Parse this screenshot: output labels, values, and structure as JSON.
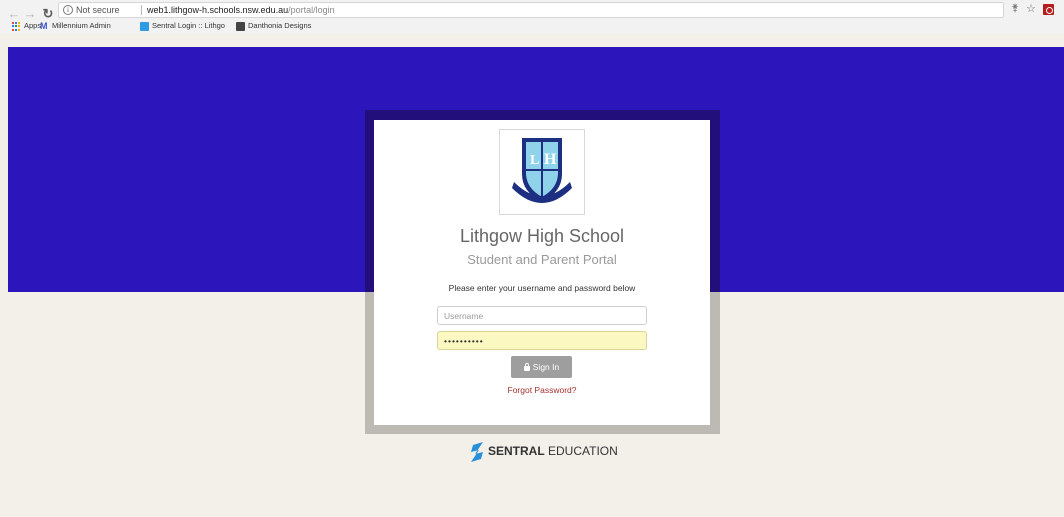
{
  "browser": {
    "security_text": "Not secure",
    "url_host": "web1.lithgow-h.schools.nsw.edu.au",
    "url_path": "/portal/login",
    "bookmarks": [
      {
        "label": "Apps"
      },
      {
        "label": "Millennium Admin"
      },
      {
        "label": "Sentral Login :: Lithgo"
      },
      {
        "label": "Danthonia Designs"
      }
    ]
  },
  "login": {
    "school_name": "Lithgow High School",
    "portal_name": "Student and Parent Portal",
    "instructions": "Please enter your username and password below",
    "username_placeholder": "Username",
    "password_value": "••••••••••",
    "signin_label": "Sign In",
    "forgot_label": "Forgot Password?"
  },
  "footer": {
    "brand_bold": "SENTRAL",
    "brand_rest": "EDUCATION"
  },
  "colors": {
    "hero": "#2b15bb",
    "frame_top": "#230f7c",
    "frame_bottom": "#bdbab4",
    "page_bg": "#f3f0ea",
    "button": "#9e9e9e",
    "link": "#a0322e",
    "autofill": "#fbf8c1"
  }
}
